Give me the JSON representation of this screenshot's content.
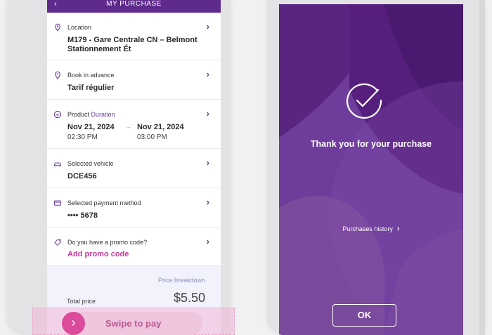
{
  "header": {
    "title": "MY PURCHASE",
    "back": "‹"
  },
  "rows": [
    {
      "label": "Location",
      "value_line1": "M179 - Gare Centrale CN – Belmont",
      "value_line2": "Stationnement Ét"
    },
    {
      "label": "Book in advance",
      "value": "Tarif régulier"
    },
    {
      "label_bold": "Product",
      "label_rest": " Duration",
      "start_date": "Nov 21, 2024",
      "start_time": "02:30 PM",
      "end_date": "Nov 21, 2024",
      "end_time": "03:00 PM",
      "arrow": "→"
    },
    {
      "label": "Selected vehicle",
      "value": "DCE456"
    },
    {
      "label": "Selected payment method",
      "value": "•••• 5678"
    },
    {
      "label": "Do you have a promo code?",
      "value": "Add promo code"
    }
  ],
  "chevron": "›",
  "price": {
    "breakdown_link": "Price breakdown",
    "total_label": "Total price",
    "total_value": "$5.50"
  },
  "swipe": {
    "label": "Swipe to pay",
    "knob": "›"
  },
  "confirmation": {
    "message": "Thank you for your purchase",
    "history_link": "Purchases history",
    "history_chevron": "›",
    "ok_button": "OK"
  },
  "colors": {
    "brand_purple": "#5e2a8c",
    "accent_pink": "#dc4a9b",
    "promo_pink": "#c5339b"
  }
}
